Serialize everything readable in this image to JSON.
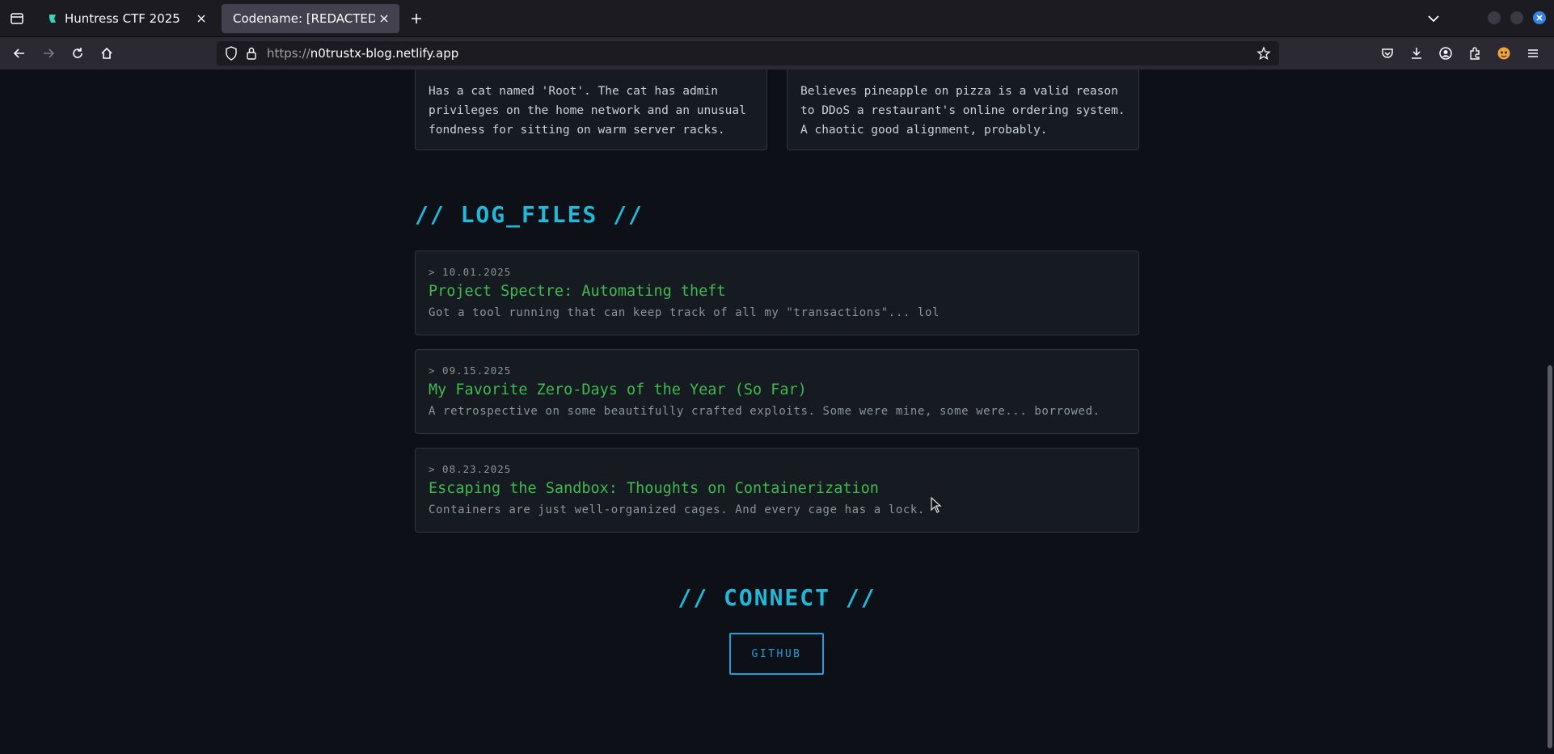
{
  "browser": {
    "tabs": [
      {
        "label": "Huntress CTF 2025",
        "active": false,
        "favicon": "huntress-favicon"
      },
      {
        "label": "Codename: [REDACTED]",
        "active": true
      }
    ],
    "url_scheme": "https://",
    "url_host": "n0trustx-blog.netlify.app"
  },
  "facts": [
    {
      "text": "Has a cat named 'Root'. The cat has admin privileges on the home network and an unusual fondness for sitting on warm server racks."
    },
    {
      "text": "Believes pineapple on pizza is a valid reason to DDoS a restaurant's online ordering system. A chaotic good alignment, probably."
    }
  ],
  "log_files": {
    "heading": "// LOG_FILES //",
    "posts": [
      {
        "date": "> 10.01.2025",
        "title": "Project Spectre: Automating theft",
        "description": "Got a tool running that can keep track of all my \"transactions\"... lol"
      },
      {
        "date": "> 09.15.2025",
        "title": "My Favorite Zero-Days of the Year (So Far)",
        "description": "A retrospective on some beautifully crafted exploits. Some were mine, some were... borrowed."
      },
      {
        "date": "> 08.23.2025",
        "title": "Escaping the Sandbox: Thoughts on Containerization",
        "description": "Containers are just well-organized cages. And every cage has a lock."
      }
    ]
  },
  "connect": {
    "heading": "// CONNECT //",
    "github_label": "GITHUB"
  },
  "colors": {
    "accent_cyan": "#22b8d8",
    "post_title_green": "#3fb950",
    "background": "#0d1117"
  }
}
